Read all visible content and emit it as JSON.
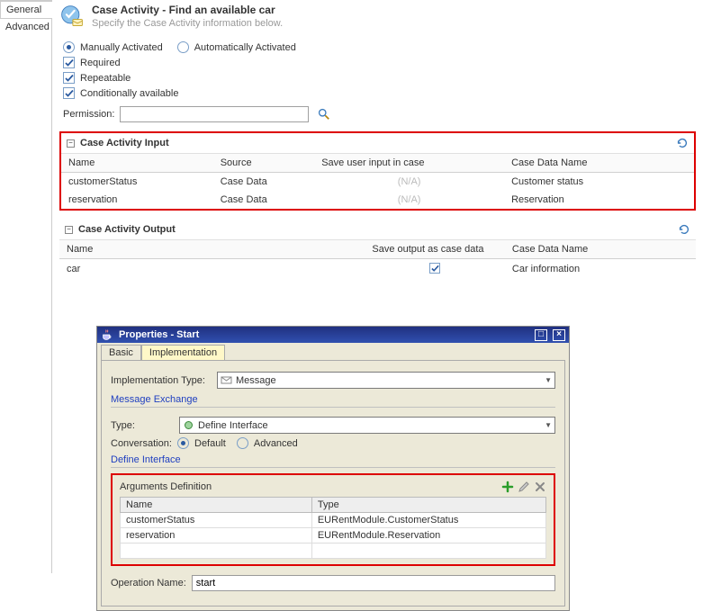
{
  "nav": {
    "general": "General",
    "advanced": "Advanced"
  },
  "header": {
    "title": "Case Activity - Find an available car",
    "subtitle": "Specify the Case Activity information below."
  },
  "activation": {
    "manual": "Manually Activated",
    "auto": "Automatically Activated",
    "required": "Required",
    "repeatable": "Repeatable",
    "conditional": "Conditionally available",
    "permission_label": "Permission:",
    "permission_value": ""
  },
  "input_section": {
    "title": "Case Activity Input",
    "cols": {
      "name": "Name",
      "source": "Source",
      "save": "Save user input in case",
      "casedata": "Case Data Name"
    },
    "rows": [
      {
        "name": "customerStatus",
        "source": "Case Data",
        "save": "(N/A)",
        "casedata": "Customer status"
      },
      {
        "name": "reservation",
        "source": "Case Data",
        "save": "(N/A)",
        "casedata": "Reservation"
      }
    ]
  },
  "output_section": {
    "title": "Case Activity Output",
    "cols": {
      "name": "Name",
      "save": "Save output as case data",
      "casedata": "Case Data Name"
    },
    "rows": [
      {
        "name": "car",
        "save_checked": true,
        "casedata": "Car information"
      }
    ]
  },
  "dialog": {
    "title": "Properties - Start",
    "tabs": {
      "basic": "Basic",
      "impl": "Implementation"
    },
    "impl_type_label": "Implementation Type:",
    "impl_type_value": "Message",
    "msg_exchange_label": "Message Exchange",
    "type_label": "Type:",
    "type_value": "Define Interface",
    "conv_label": "Conversation:",
    "conv_default": "Default",
    "conv_advanced": "Advanced",
    "define_label": "Define Interface",
    "args_title": "Arguments Definition",
    "args_cols": {
      "name": "Name",
      "type": "Type"
    },
    "args_rows": [
      {
        "name": "customerStatus",
        "type": "EURentModule.CustomerStatus"
      },
      {
        "name": "reservation",
        "type": "EURentModule.Reservation"
      }
    ],
    "opname_label": "Operation Name:",
    "opname_value": "start"
  }
}
